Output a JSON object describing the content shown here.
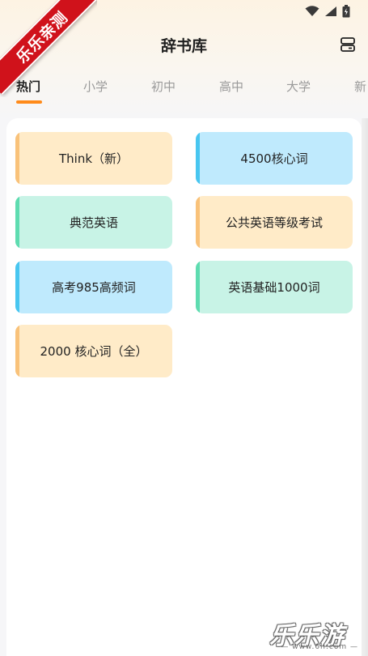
{
  "ribbon": {
    "text": "乐乐亲测"
  },
  "header": {
    "title": "辞书库",
    "action_icon": "bookshelf-icon"
  },
  "status_bar": {
    "icons": [
      "wifi-icon",
      "signal-icon",
      "battery-icon"
    ]
  },
  "tabs": [
    {
      "label": "热门",
      "active": true
    },
    {
      "label": "小学",
      "active": false
    },
    {
      "label": "初中",
      "active": false
    },
    {
      "label": "高中",
      "active": false
    },
    {
      "label": "大学",
      "active": false
    },
    {
      "label": "新",
      "active": false
    }
  ],
  "books": [
    {
      "label": "Think（新）",
      "color": "orange"
    },
    {
      "label": "4500核心词",
      "color": "blue"
    },
    {
      "label": "典范英语",
      "color": "green"
    },
    {
      "label": "公共英语等级考试",
      "color": "orange"
    },
    {
      "label": "高考985高频词",
      "color": "blue"
    },
    {
      "label": "英语基础1000词",
      "color": "green"
    },
    {
      "label": "2000 核心词（全）",
      "color": "orange"
    }
  ],
  "colors": {
    "orange_bg": "#ffebc8",
    "orange_accent": "#f9c27a",
    "blue_bg": "#bfeafd",
    "blue_accent": "#48c6f0",
    "green_bg": "#c8f3e6",
    "green_accent": "#5edcb0",
    "tab_indicator": "#ff8a1a",
    "ribbon": "#d0121b"
  },
  "watermark": {
    "main": "乐乐游戏",
    "sub": "— www.6ll.com —"
  }
}
